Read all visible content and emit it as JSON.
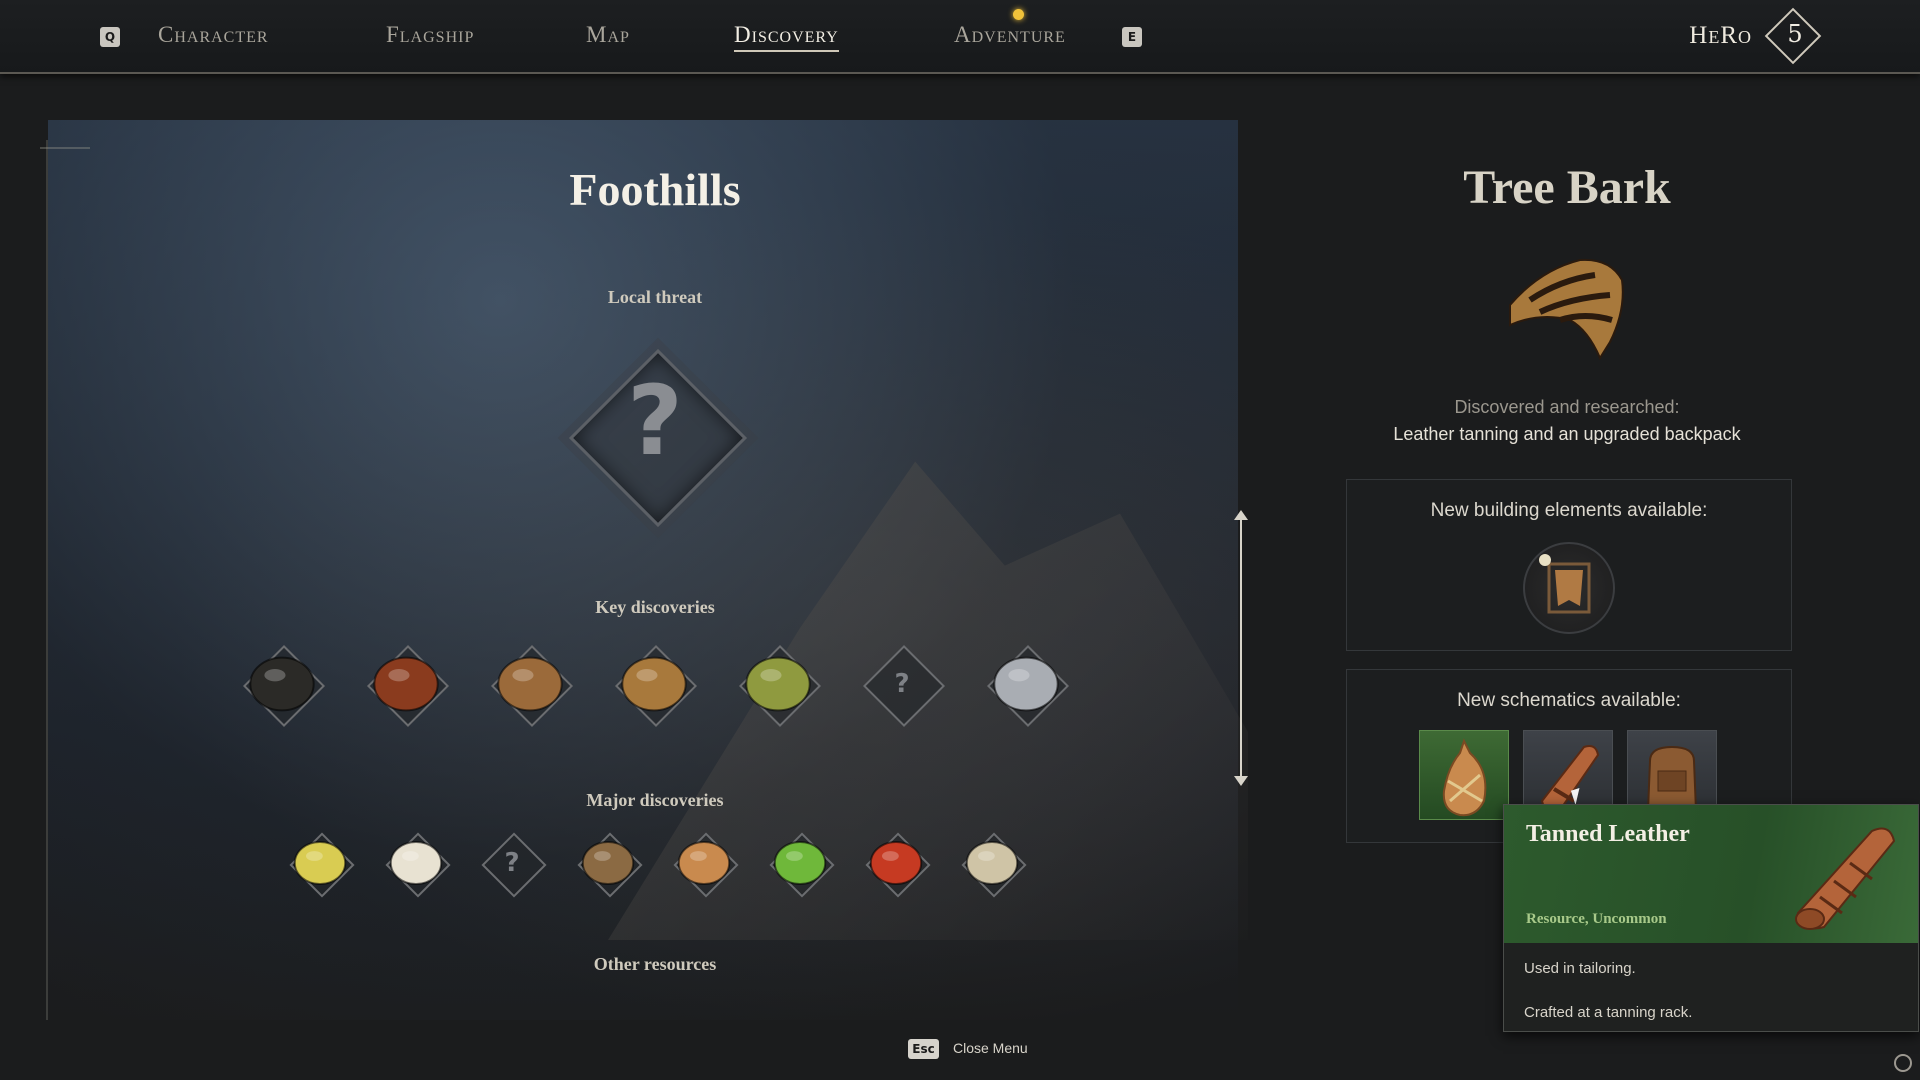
{
  "nav": {
    "left_key": "Q",
    "right_key": "E",
    "tabs": [
      {
        "label": "Character"
      },
      {
        "label": "Flagship"
      },
      {
        "label": "Map"
      },
      {
        "label": "Discovery",
        "active": true
      },
      {
        "label": "Adventure",
        "has_notification": true
      }
    ],
    "hero_name": "HeRo",
    "hero_level": "5"
  },
  "region": {
    "title": "Foothills",
    "local_threat_label": "Local threat",
    "local_threat_unknown": "?",
    "key_discoveries_label": "Key discoveries",
    "key_discoveries": [
      {
        "icon": "coal-icon",
        "color": "#2b2a27"
      },
      {
        "icon": "copper-ore-icon",
        "color": "#8a3b1e"
      },
      {
        "icon": "wood-logs-icon",
        "color": "#9b6a3a"
      },
      {
        "icon": "tree-bark-icon",
        "color": "#a8793c"
      },
      {
        "icon": "herb-bundle-icon",
        "color": "#8f9a3f"
      },
      {
        "icon": "unknown-icon",
        "unknown": true
      },
      {
        "icon": "iron-ingot-icon",
        "color": "#a9adb3"
      }
    ],
    "major_discoveries_label": "Major discoveries",
    "major_discoveries": [
      {
        "icon": "sulfur-crystal-icon",
        "color": "#d9cc52"
      },
      {
        "icon": "fang-icon",
        "color": "#e8e2d2"
      },
      {
        "icon": "unknown-icon",
        "unknown": true
      },
      {
        "icon": "seed-sack-icon",
        "color": "#8b6a43"
      },
      {
        "icon": "beans-icon",
        "color": "#c98a4e"
      },
      {
        "icon": "lime-icon",
        "color": "#6fb83a"
      },
      {
        "icon": "tomato-icon",
        "color": "#c63a22"
      },
      {
        "icon": "spore-icon",
        "color": "#cfc4a6"
      }
    ],
    "other_resources_label": "Other resources"
  },
  "detail": {
    "title": "Tree Bark",
    "icon": "tree-bark-icon",
    "status": "Discovered and researched:",
    "description": "Leather tanning and an upgraded backpack",
    "building_label": "New building elements available:",
    "building_items": [
      {
        "icon": "tanning-rack-icon"
      }
    ],
    "schematics_label": "New schematics available:",
    "schematics": [
      {
        "icon": "waterskin-icon",
        "selected": true
      },
      {
        "icon": "tanned-leather-icon"
      },
      {
        "icon": "backpack-icon"
      }
    ]
  },
  "tooltip": {
    "name": "Tanned Leather",
    "type": "Resource, Uncommon",
    "line1": "Used in tailoring.",
    "line2": "Crafted at a tanning rack.",
    "icon": "tanned-leather-icon"
  },
  "footer": {
    "close_key": "Esc",
    "close_label": "Close Menu"
  },
  "colors": {
    "accent_gold": "#f0c23a",
    "tooltip_green": "#2d5a2d",
    "rarity_green": "#a8c98a"
  }
}
